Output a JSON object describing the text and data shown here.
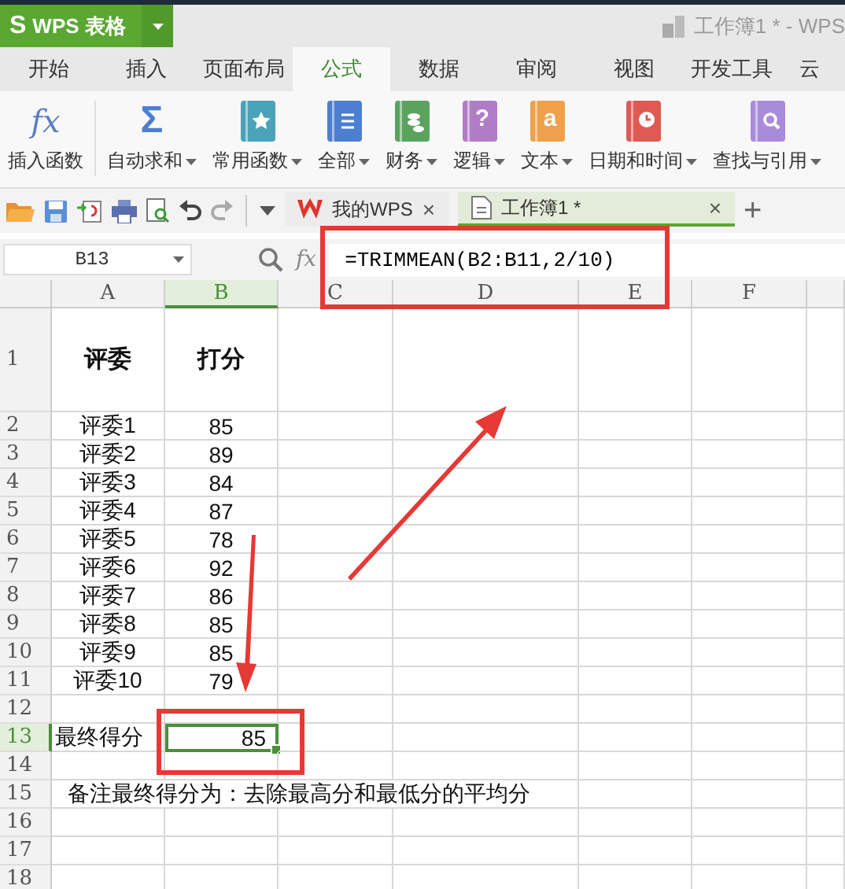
{
  "app": {
    "logo": "S",
    "name": "WPS 表格",
    "title": "工作簿1 * - WPS"
  },
  "tabs": [
    {
      "label": "开始",
      "selected": false
    },
    {
      "label": "插入",
      "selected": false
    },
    {
      "label": "页面布局",
      "selected": false
    },
    {
      "label": "公式",
      "selected": true
    },
    {
      "label": "数据",
      "selected": false
    },
    {
      "label": "审阅",
      "selected": false
    },
    {
      "label": "视图",
      "selected": false
    },
    {
      "label": "开发工具",
      "selected": false
    },
    {
      "label": "云",
      "selected": false
    }
  ],
  "ribbon": [
    {
      "label": "插入函数",
      "kind": "fx",
      "glyph": "fx",
      "dropdown": false
    },
    {
      "label": "自动求和",
      "kind": "sigma",
      "glyph": "Σ",
      "dropdown": true
    },
    {
      "label": "常用函数",
      "kind": "star",
      "color": "#4aa3b8",
      "dropdown": true
    },
    {
      "label": "全部",
      "kind": "list",
      "color": "#4d7fd0",
      "dropdown": true
    },
    {
      "label": "财务",
      "kind": "coins",
      "color": "#5aa35f",
      "dropdown": true
    },
    {
      "label": "逻辑",
      "kind": "question",
      "glyph": "?",
      "color": "#b07cc6",
      "dropdown": true
    },
    {
      "label": "文本",
      "kind": "letter",
      "glyph": "a",
      "color": "#eea04a",
      "dropdown": true
    },
    {
      "label": "日期和时间",
      "kind": "clock",
      "color": "#e05a54",
      "dropdown": true
    },
    {
      "label": "查找与引用",
      "kind": "search",
      "color": "#a98bdc",
      "dropdown": true
    }
  ],
  "doc_tabs": [
    {
      "label": "我的WPS",
      "kind": "home",
      "selected": false,
      "close": "×"
    },
    {
      "label": "工作簿1 *",
      "kind": "sheet",
      "selected": true,
      "close": "×"
    }
  ],
  "new_tab": "+",
  "name_box": "B13",
  "fx_label": "fx",
  "formula": "=TRIMMEAN(B2:B11,2/10)",
  "columns": [
    {
      "label": "A",
      "selected": false
    },
    {
      "label": "B",
      "selected": true
    },
    {
      "label": "C",
      "selected": false
    },
    {
      "label": "D",
      "selected": false
    },
    {
      "label": "E",
      "selected": false
    },
    {
      "label": "F",
      "selected": false
    }
  ],
  "rows": [
    {
      "label": "1",
      "kind": "header",
      "selected": false,
      "cells": [
        "评委",
        "打分"
      ]
    },
    {
      "label": "2",
      "kind": "data",
      "selected": false,
      "cells": [
        "评委1",
        "85"
      ]
    },
    {
      "label": "3",
      "kind": "data",
      "selected": false,
      "cells": [
        "评委2",
        "89"
      ]
    },
    {
      "label": "4",
      "kind": "data",
      "selected": false,
      "cells": [
        "评委3",
        "84"
      ]
    },
    {
      "label": "5",
      "kind": "data",
      "selected": false,
      "cells": [
        "评委4",
        "87"
      ]
    },
    {
      "label": "6",
      "kind": "data",
      "selected": false,
      "cells": [
        "评委5",
        "78"
      ]
    },
    {
      "label": "7",
      "kind": "data",
      "selected": false,
      "cells": [
        "评委6",
        "92"
      ]
    },
    {
      "label": "8",
      "kind": "data",
      "selected": false,
      "cells": [
        "评委7",
        "86"
      ]
    },
    {
      "label": "9",
      "kind": "data",
      "selected": false,
      "cells": [
        "评委8",
        "85"
      ]
    },
    {
      "label": "10",
      "kind": "data",
      "selected": false,
      "cells": [
        "评委9",
        "85"
      ]
    },
    {
      "label": "11",
      "kind": "data",
      "selected": false,
      "cells": [
        "评委10",
        "79"
      ]
    },
    {
      "label": "12",
      "kind": "data",
      "selected": false,
      "cells": []
    },
    {
      "label": "13",
      "kind": "result",
      "selected": true,
      "cells": [
        "最终得分",
        "85"
      ]
    },
    {
      "label": "14",
      "kind": "data",
      "selected": false,
      "cells": []
    },
    {
      "label": "15",
      "kind": "note",
      "selected": false,
      "cells": [
        "备注最终得分为：去除最高分和最低分的平均分"
      ]
    },
    {
      "label": "16",
      "kind": "data",
      "selected": false,
      "cells": []
    },
    {
      "label": "17",
      "kind": "data",
      "selected": false,
      "cells": []
    },
    {
      "label": "18",
      "kind": "data",
      "selected": false,
      "cells": []
    }
  ]
}
